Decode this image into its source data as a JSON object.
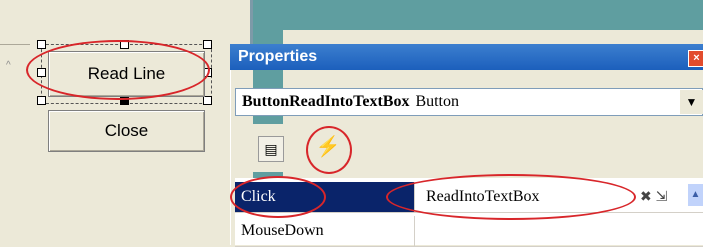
{
  "designer": {
    "buttons": [
      {
        "label": "Read Line"
      },
      {
        "label": "Close"
      }
    ]
  },
  "properties_panel": {
    "title": "Properties",
    "object_selector": {
      "name": "ButtonReadIntoTextBox",
      "type": "Button"
    },
    "toolbar": {
      "properties_icon": "properties-list-icon",
      "events_icon": "lightning-bolt-icon"
    },
    "events": [
      {
        "name": "Click",
        "value": "ReadIntoTextBox",
        "selected": true
      },
      {
        "name": "MouseDown",
        "value": ""
      }
    ]
  },
  "colors": {
    "annotation": "#d8262a",
    "titlebar": "#1c5fbc",
    "selection": "#0a246a",
    "background_teal": "#5f9ea0"
  }
}
